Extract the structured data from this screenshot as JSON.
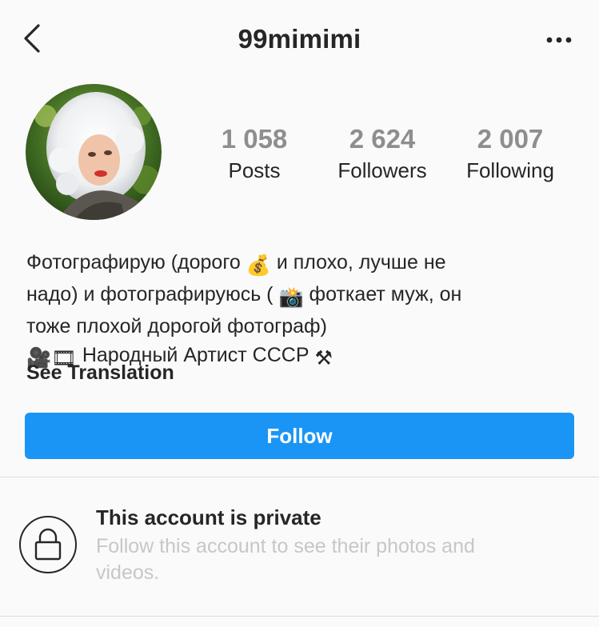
{
  "header": {
    "username": "99mimimi",
    "back_icon": "chevron-left-icon",
    "more_icon": "more-horizontal-icon"
  },
  "profile": {
    "avatar_alt": "profile photo",
    "stats": [
      {
        "value": "1 058",
        "label": "Posts"
      },
      {
        "value": "2 624",
        "label": "Followers"
      },
      {
        "value": "2 007",
        "label": "Following"
      }
    ]
  },
  "bio": {
    "line1_a": "Фотографирую (дорого ",
    "line1_emoji": "💰",
    "line1_b": " и плохо, лучше не",
    "line2_a": "надо) и фотографируюсь ( ",
    "line2_emoji": "📸",
    "line2_b": " фоткает муж, он",
    "line3": "тоже плохой дорогой фотограф)",
    "line4_emoji1": "🎥",
    "line4_emoji2": "🎞",
    "line4_text": " Народный Артист СССР ",
    "line4_emoji3": "⚒",
    "see_translation": "See Translation"
  },
  "actions": {
    "follow_label": "Follow"
  },
  "private_notice": {
    "title": "This account is private",
    "description": "Follow this account to see their photos and videos."
  },
  "colors": {
    "accent": "#1a95f6",
    "stat_number": "#8e8e8e",
    "muted_text": "#c7c7c7",
    "background": "#fafafa"
  }
}
